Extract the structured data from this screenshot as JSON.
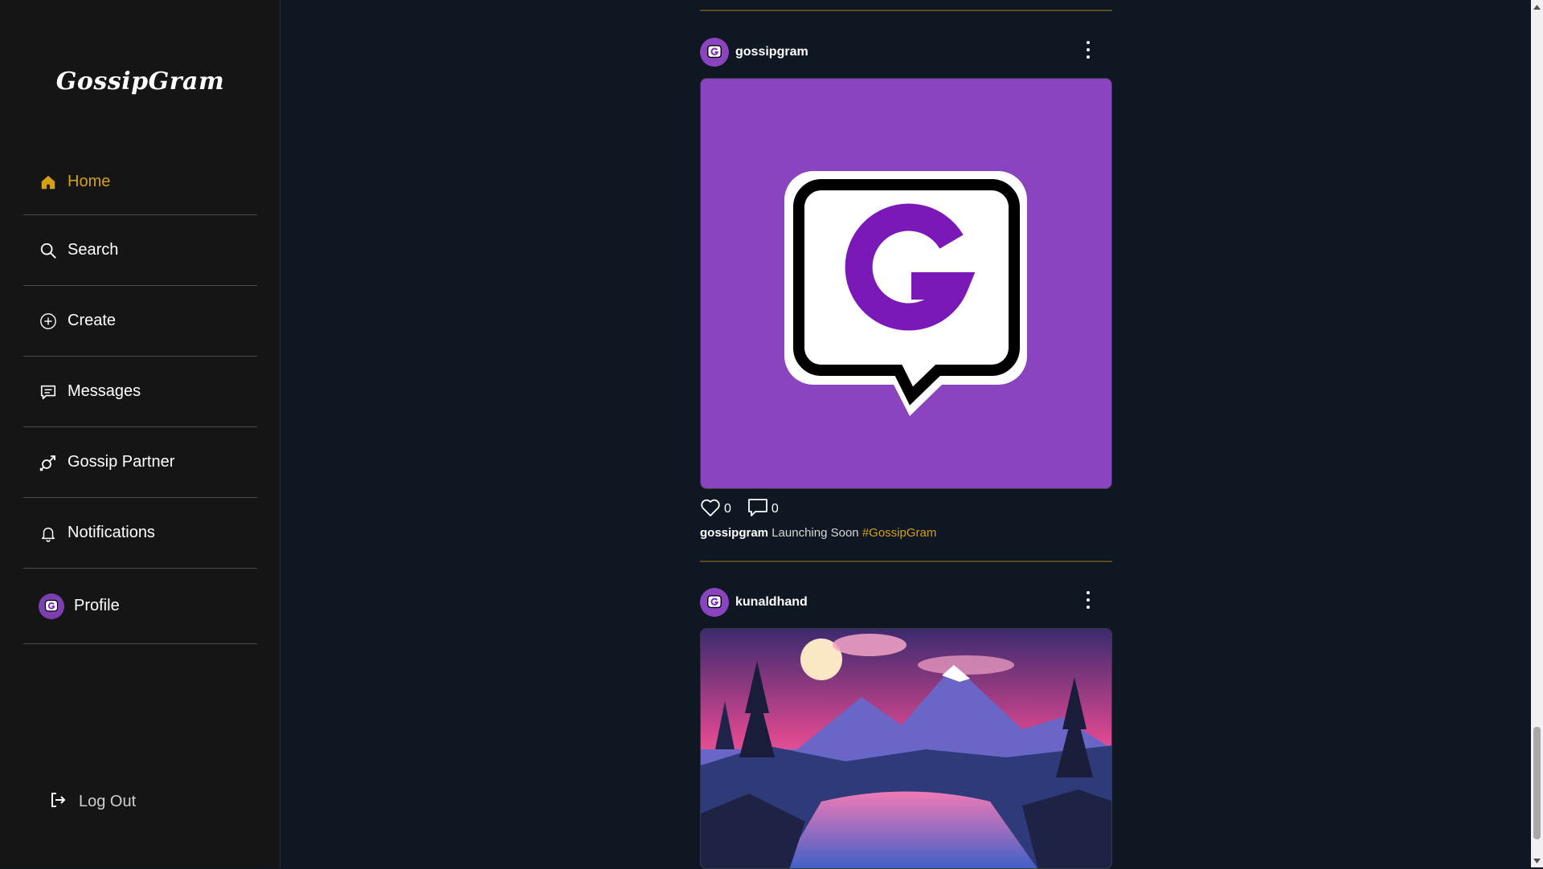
{
  "app": {
    "logo_text": "GossipGram"
  },
  "sidebar": {
    "items": [
      {
        "label": "Home",
        "icon": "home-icon",
        "active": true
      },
      {
        "label": "Search",
        "icon": "search-icon"
      },
      {
        "label": "Create",
        "icon": "plus-circle-icon"
      },
      {
        "label": "Messages",
        "icon": "message-icon"
      },
      {
        "label": "Gossip Partner",
        "icon": "gender-icon"
      },
      {
        "label": "Notifications",
        "icon": "bell-icon"
      },
      {
        "label": "Profile",
        "icon": "avatar"
      }
    ],
    "logout_label": "Log Out"
  },
  "feed": {
    "posts": [
      {
        "username": "gossipgram",
        "likes": "0",
        "comments": "0",
        "caption_user": "gossipgram",
        "caption_text": "Launching Soon",
        "hashtag": "#GossipGram",
        "image": "gossipgram-logo"
      },
      {
        "username": "kunaldhand",
        "image": "mountain-lake-landscape"
      }
    ]
  },
  "colors": {
    "accent": "#d4a017",
    "brand_purple": "#8a44bf",
    "background": "#0f1722",
    "sidebar_bg": "#151515"
  }
}
